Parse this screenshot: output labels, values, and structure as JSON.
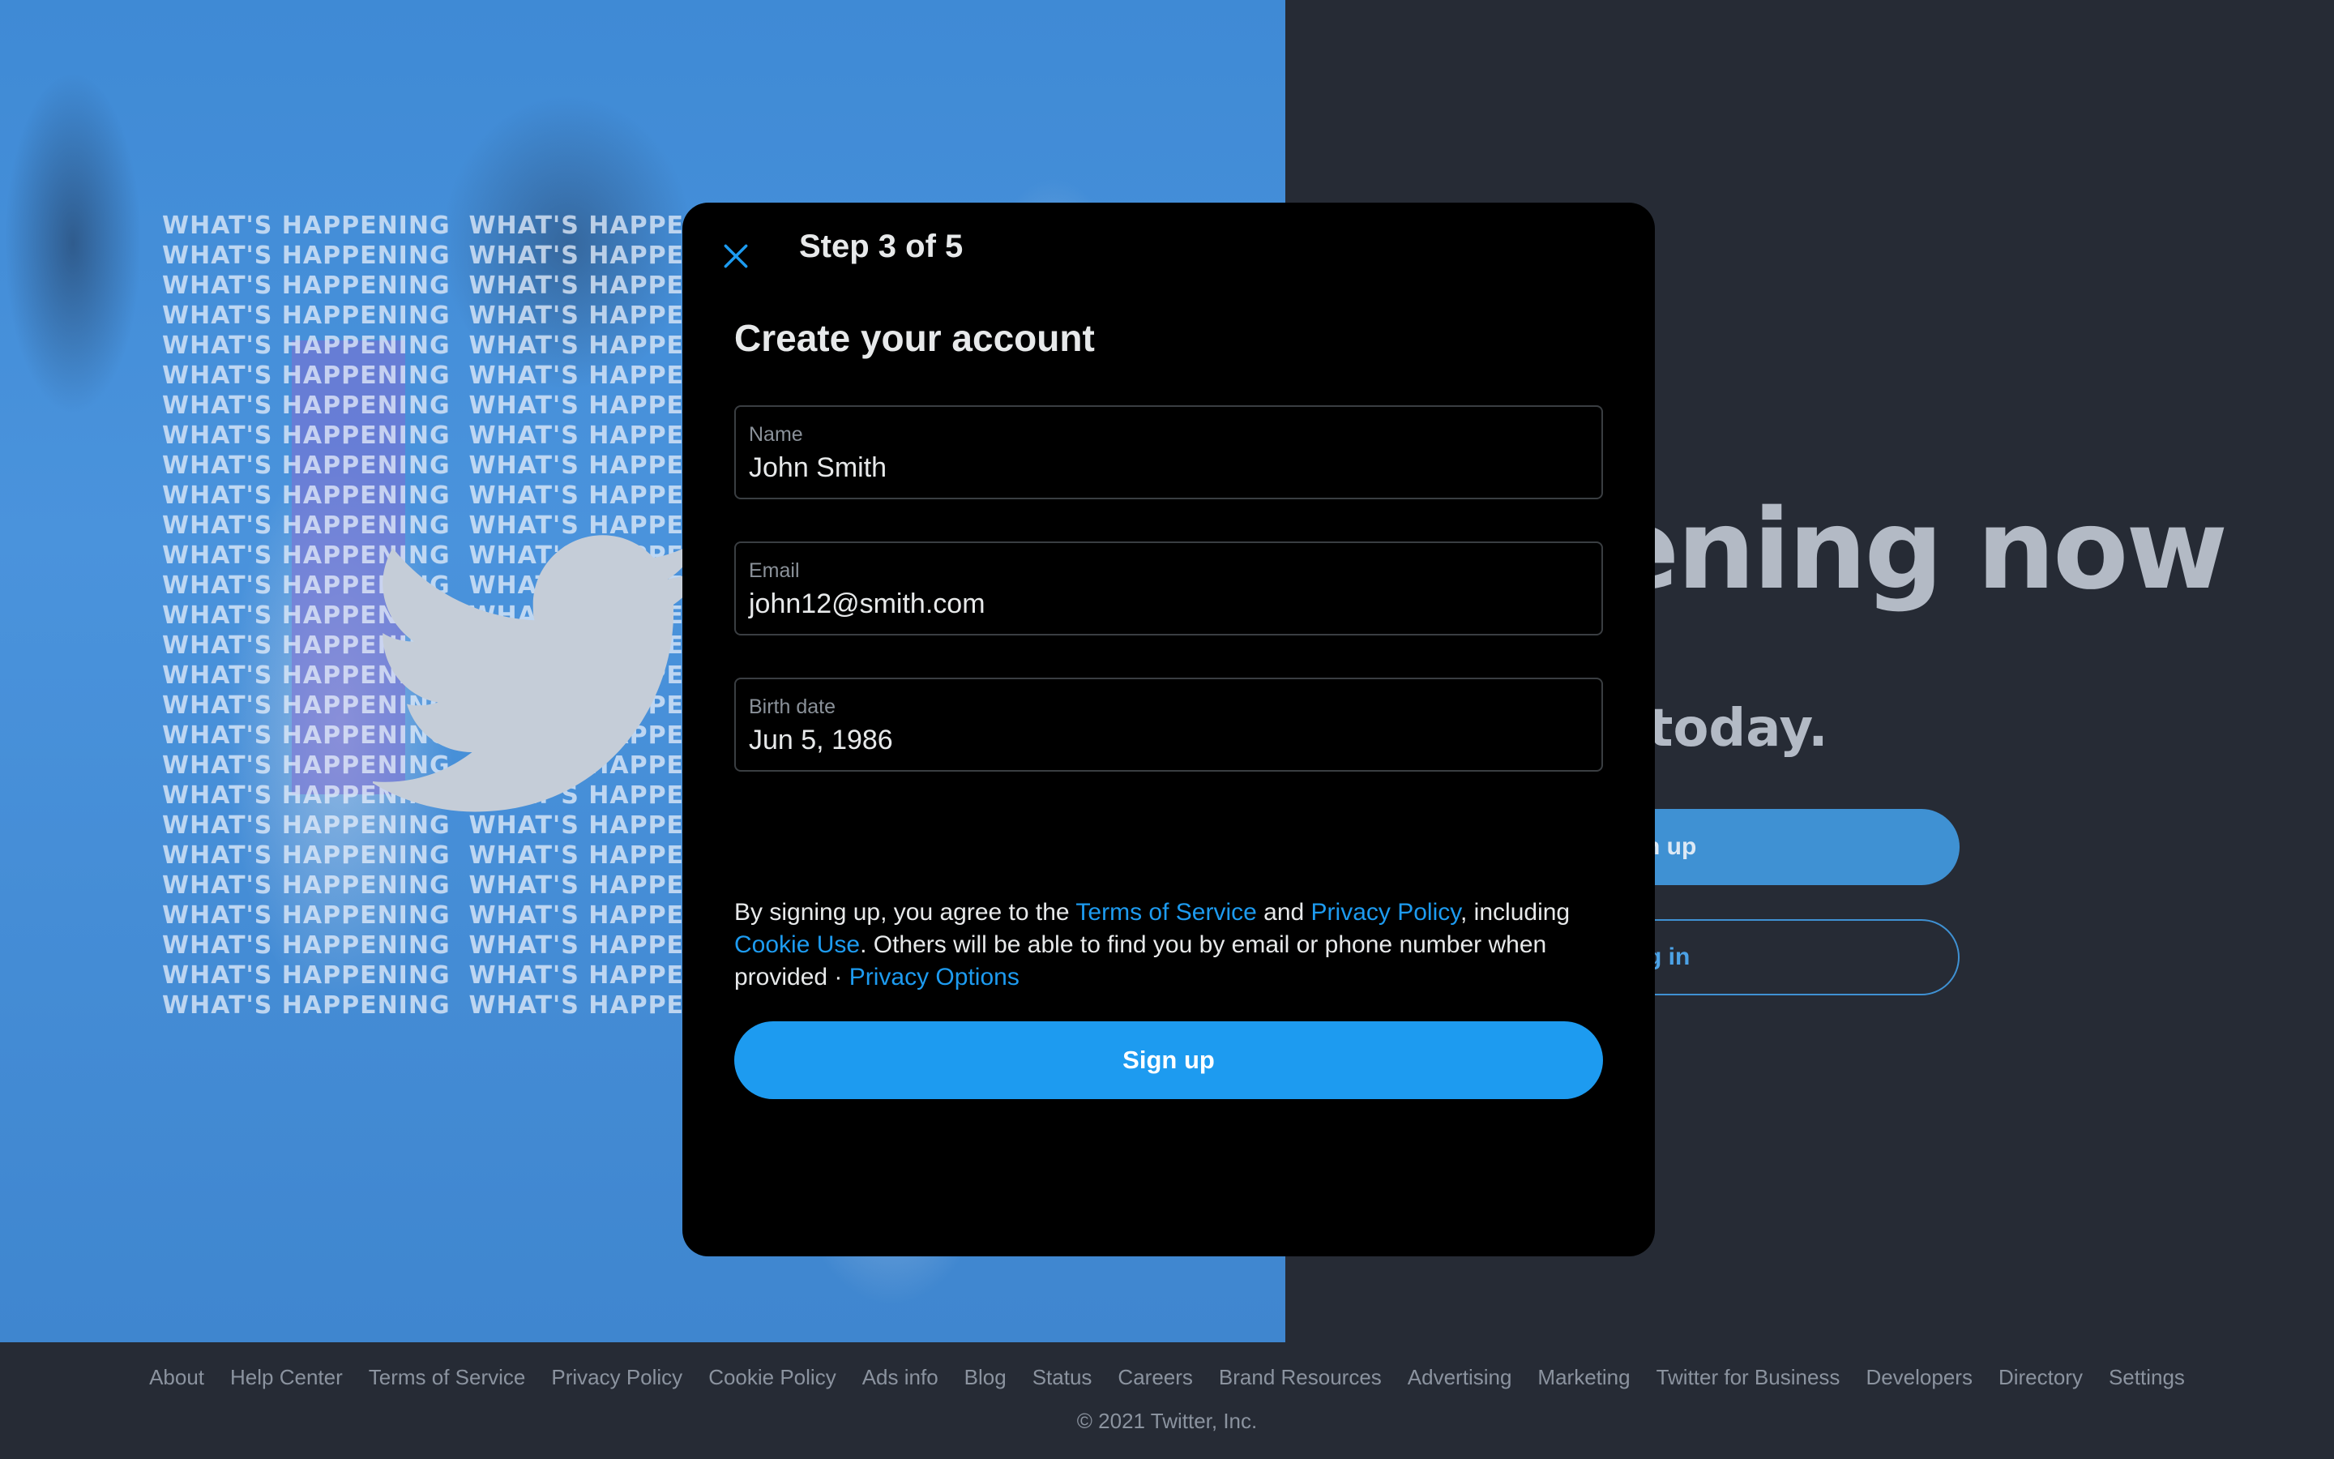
{
  "background": {
    "hero_title": "ening now",
    "hero_subtitle": "r today.",
    "signup_fragment": "n up",
    "login_fragment": "g in",
    "artwork_text": "WHAT'S HAPPENING"
  },
  "modal": {
    "step": "Step 3 of 5",
    "title": "Create your account",
    "fields": {
      "name": {
        "label": "Name",
        "value": "John Smith"
      },
      "email": {
        "label": "Email",
        "value": "john12@smith.com"
      },
      "birth_date": {
        "label": "Birth date",
        "value": "Jun 5, 1986"
      }
    },
    "legal": {
      "part1": "By signing up, you agree to the ",
      "terms_link": "Terms of Service",
      "part2": " and ",
      "privacy_link": "Privacy Policy",
      "part3": ", including ",
      "cookie_link": "Cookie Use",
      "part4": ". Others will be able to find you by email or phone number when provided · ",
      "privacy_options_link": "Privacy Options"
    },
    "signup_label": "Sign up"
  },
  "footer": {
    "links": [
      "About",
      "Help Center",
      "Terms of Service",
      "Privacy Policy",
      "Cookie Policy",
      "Ads info",
      "Blog",
      "Status",
      "Careers",
      "Brand Resources",
      "Advertising",
      "Marketing",
      "Twitter for Business",
      "Developers",
      "Directory",
      "Settings"
    ],
    "copyright": "© 2021 Twitter, Inc."
  },
  "colors": {
    "accent": "#1d9bf0",
    "modal_bg": "#000000",
    "page_bg": "#262b35"
  },
  "icons": [
    "close-icon",
    "twitter-bird-icon"
  ]
}
